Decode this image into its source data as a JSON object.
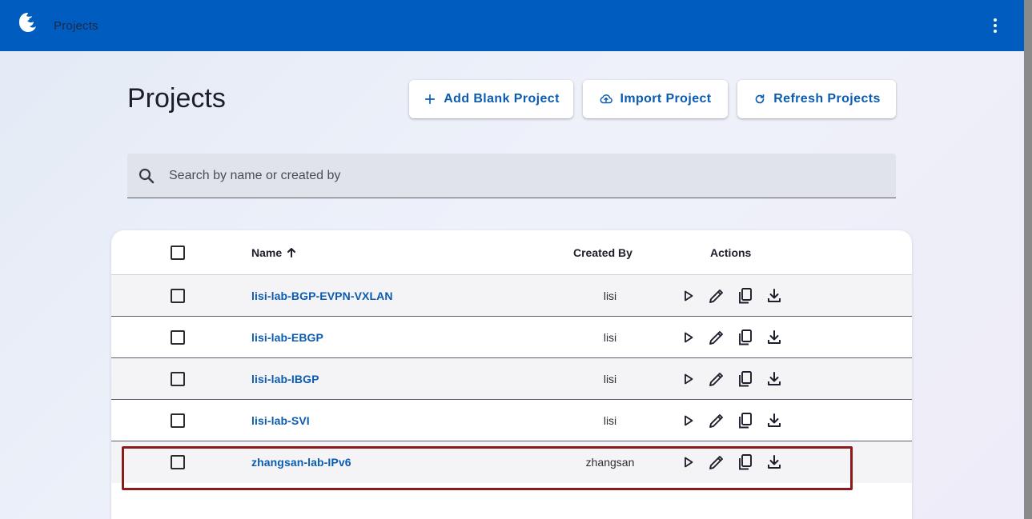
{
  "topbar": {
    "title": "Projects",
    "background": "#005cbf",
    "logo_icon": "app-logo-icon",
    "menu_icon": "more-vert-icon"
  },
  "page": {
    "title": "Projects"
  },
  "toolbar": {
    "add_label": "Add Blank Project",
    "add_icon": "plus-icon",
    "import_label": "Import Project",
    "import_icon": "cloud-upload-icon",
    "refresh_label": "Refresh Projects",
    "refresh_icon": "refresh-icon"
  },
  "search": {
    "placeholder": "Search by name or created by",
    "value": "",
    "icon": "search-icon"
  },
  "table": {
    "columns": {
      "name": "Name",
      "name_sort": "ascending",
      "created_by": "Created By",
      "actions": "Actions"
    },
    "rows": [
      {
        "name": "lisi-lab-BGP-EVPN-VXLAN",
        "created_by": "lisi"
      },
      {
        "name": "lisi-lab-EBGP",
        "created_by": "lisi"
      },
      {
        "name": "lisi-lab-IBGP",
        "created_by": "lisi"
      },
      {
        "name": "lisi-lab-SVI",
        "created_by": "lisi"
      },
      {
        "name": "zhangsan-lab-IPv6",
        "created_by": "zhangsan"
      }
    ],
    "row_action_icons": [
      "play-icon",
      "edit-pencil-icon",
      "copy-icon",
      "download-icon"
    ],
    "highlighted_row": 4,
    "highlight_color": "#8b1a1a"
  }
}
